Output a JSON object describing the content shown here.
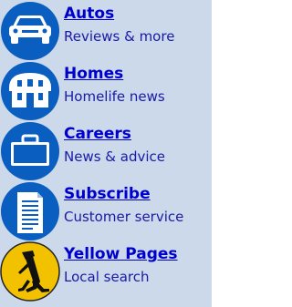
{
  "panel": {
    "bg_color": "#ccd9eb",
    "icon_color": "#0a5ec0",
    "yellow_icon_color": "#f2c200",
    "link_color": "#0000cc",
    "desc_color": "#1a1aa6"
  },
  "items": [
    {
      "title": "Autos",
      "description": "Reviews & more",
      "icon": "car-icon"
    },
    {
      "title": "Homes",
      "description": "Homelife news",
      "icon": "house-icon"
    },
    {
      "title": "Careers",
      "description": "News & advice",
      "icon": "briefcase-icon"
    },
    {
      "title": "Subscribe",
      "description": "Customer service",
      "icon": "document-icon"
    },
    {
      "title": "Yellow Pages",
      "description": "Local search",
      "icon": "walking-fingers-icon"
    }
  ]
}
